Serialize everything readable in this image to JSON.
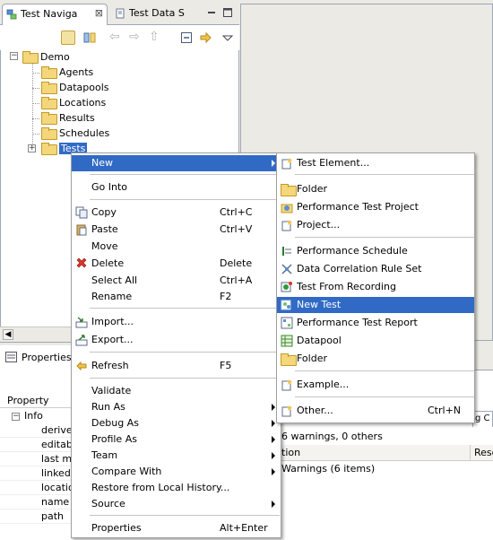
{
  "navigator": {
    "tab_title": "Test Naviga",
    "close_glyph": "⊠",
    "inactive_tab_title": "Test Data S",
    "tree": {
      "root": "Demo",
      "children": [
        "Agents",
        "Datapools",
        "Locations",
        "Results",
        "Schedules"
      ],
      "selected": "Tests"
    }
  },
  "properties": {
    "tab_title": "Properties",
    "column_header": "Property",
    "group": "Info",
    "rows": [
      "derived",
      "editabl",
      "last mo",
      "linked",
      "locatio",
      "name",
      "path"
    ]
  },
  "problems": {
    "summary": "6 warnings, 0 others",
    "column_left": "tion",
    "column_right": "Reso",
    "row": "Warnings (6 items)",
    "tab_partial": "g C"
  },
  "context_menu": {
    "items": [
      {
        "label": "New",
        "shortcut": "",
        "submenu": true
      },
      {
        "label": "Go Into",
        "shortcut": ""
      },
      {
        "label": "Copy",
        "shortcut": "Ctrl+C"
      },
      {
        "label": "Paste",
        "shortcut": "Ctrl+V"
      },
      {
        "label": "Move",
        "shortcut": ""
      },
      {
        "label": "Delete",
        "shortcut": "Delete"
      },
      {
        "label": "Select All",
        "shortcut": "Ctrl+A"
      },
      {
        "label": "Rename",
        "shortcut": "F2"
      },
      {
        "label": "Import...",
        "shortcut": ""
      },
      {
        "label": "Export...",
        "shortcut": ""
      },
      {
        "label": "Refresh",
        "shortcut": "F5"
      },
      {
        "label": "Validate",
        "shortcut": ""
      },
      {
        "label": "Run As",
        "shortcut": "",
        "submenu": true
      },
      {
        "label": "Debug As",
        "shortcut": "",
        "submenu": true
      },
      {
        "label": "Profile As",
        "shortcut": "",
        "submenu": true
      },
      {
        "label": "Team",
        "shortcut": "",
        "submenu": true
      },
      {
        "label": "Compare With",
        "shortcut": "",
        "submenu": true
      },
      {
        "label": "Restore from Local History...",
        "shortcut": ""
      },
      {
        "label": "Source",
        "shortcut": "",
        "submenu": true
      },
      {
        "label": "Properties",
        "shortcut": "Alt+Enter"
      }
    ]
  },
  "submenu": {
    "items": [
      {
        "label": "Test Element...",
        "shortcut": ""
      },
      {
        "label": "Folder",
        "shortcut": ""
      },
      {
        "label": "Performance Test Project",
        "shortcut": ""
      },
      {
        "label": "Project...",
        "shortcut": ""
      },
      {
        "label": "Performance Schedule",
        "shortcut": ""
      },
      {
        "label": "Data Correlation Rule Set",
        "shortcut": ""
      },
      {
        "label": "Test From Recording",
        "shortcut": ""
      },
      {
        "label": "New Test",
        "shortcut": "",
        "highlighted": true
      },
      {
        "label": "Performance Test Report",
        "shortcut": ""
      },
      {
        "label": "Datapool",
        "shortcut": ""
      },
      {
        "label": "Folder",
        "shortcut": ""
      },
      {
        "label": "Example...",
        "shortcut": ""
      },
      {
        "label": "Other...",
        "shortcut": "Ctrl+N"
      }
    ]
  },
  "colors": {
    "selection": "#316ac5",
    "folder": "#f3d77a",
    "chrome": "#eceae4",
    "border": "#9ca7b8"
  }
}
